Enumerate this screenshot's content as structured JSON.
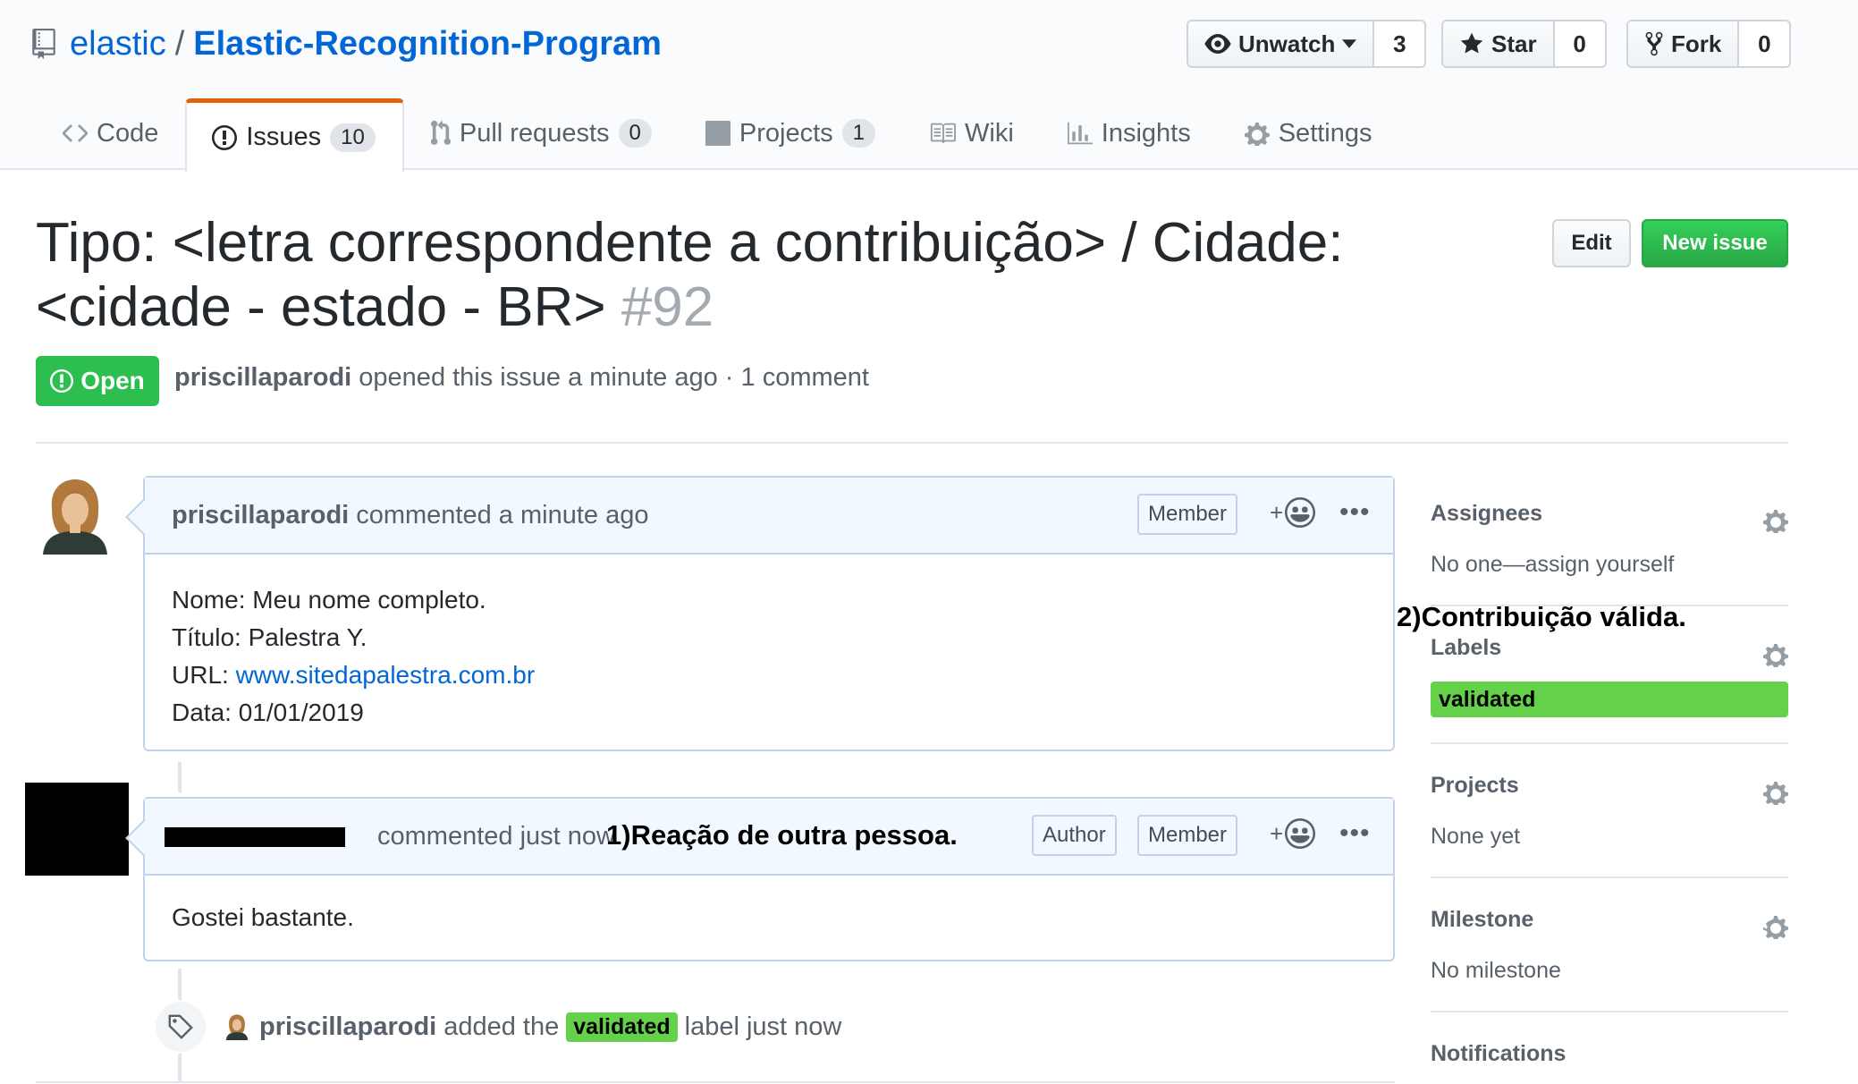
{
  "repo": {
    "owner": "elastic",
    "separator": "/",
    "name": "Elastic-Recognition-Program"
  },
  "actions": {
    "unwatch_label": "Unwatch",
    "watch_count": "3",
    "star_label": "Star",
    "star_count": "0",
    "fork_label": "Fork",
    "fork_count": "0"
  },
  "tabs": [
    {
      "label": "Code",
      "counter": null,
      "icon": "code-icon"
    },
    {
      "label": "Issues",
      "counter": "10",
      "icon": "issue-icon",
      "selected": true
    },
    {
      "label": "Pull requests",
      "counter": "0",
      "icon": "pull-request-icon"
    },
    {
      "label": "Projects",
      "counter": "1",
      "icon": "project-icon"
    },
    {
      "label": "Wiki",
      "counter": null,
      "icon": "book-icon"
    },
    {
      "label": "Insights",
      "counter": null,
      "icon": "graph-icon"
    },
    {
      "label": "Settings",
      "counter": null,
      "icon": "gear-icon"
    }
  ],
  "issue": {
    "title": "Tipo: <letra correspondente a contribuição> / Cidade: <cidade - estado - BR>",
    "number": "#92",
    "state": "Open",
    "author": "priscillaparodi",
    "meta_text": "opened this issue a minute ago · 1 comment",
    "edit_label": "Edit",
    "new_issue_label": "New issue"
  },
  "comments": [
    {
      "author": "priscillaparodi",
      "action": "commented a minute ago",
      "badges": [
        "Member"
      ],
      "body": [
        {
          "prefix": "Nome: ",
          "text": "Meu nome completo."
        },
        {
          "prefix": "Título: ",
          "text": "Palestra Y."
        },
        {
          "prefix": "URL: ",
          "link": "www.sitedapalestra.com.br"
        },
        {
          "prefix": "Data: ",
          "text": "01/01/2019"
        }
      ]
    },
    {
      "author": "",
      "action": "commented just now",
      "badges": [
        "Author",
        "Member"
      ],
      "body": [
        {
          "text": "Gostei bastante."
        }
      ]
    }
  ],
  "annotations": {
    "first": "1)Reação de outra pessoa.",
    "second": "2)Contribuição válida."
  },
  "event": {
    "actor": "priscillaparodi",
    "text_before": "added the",
    "label": "validated",
    "text_after": "label just now"
  },
  "sidebar": {
    "assignees_heading": "Assignees",
    "assignees_value": "No one—assign yourself",
    "labels_heading": "Labels",
    "label_value": "validated",
    "projects_heading": "Projects",
    "projects_value": "None yet",
    "milestone_heading": "Milestone",
    "milestone_value": "No milestone",
    "notifications_heading": "Notifications"
  },
  "colors": {
    "link": "#0366d6",
    "open_green": "#2cbe4e",
    "validated_label": "#65d14b",
    "tab_accent": "#e36209"
  }
}
